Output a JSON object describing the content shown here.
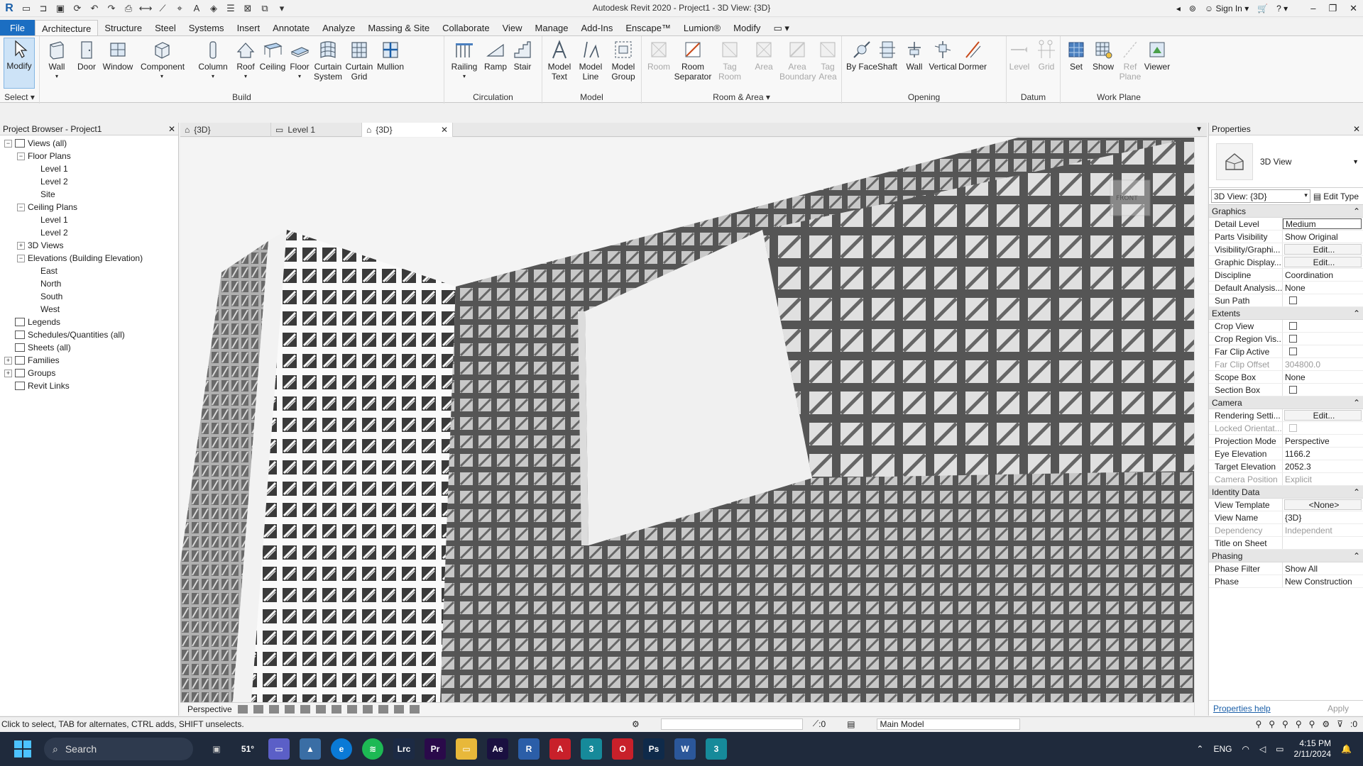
{
  "window": {
    "title": "Autodesk Revit 2020 - Project1 - 3D View: {3D}",
    "sign_in": "Sign In"
  },
  "ribbon_tabs": [
    "File",
    "Architecture",
    "Structure",
    "Steel",
    "Systems",
    "Insert",
    "Annotate",
    "Analyze",
    "Massing & Site",
    "Collaborate",
    "View",
    "Manage",
    "Add-Ins",
    "Enscape™",
    "Lumion®",
    "Modify"
  ],
  "ribbon": {
    "select": {
      "modify": "Modify",
      "title": "Select"
    },
    "build": {
      "title": "Build",
      "wall": "Wall",
      "door": "Door",
      "window": "Window",
      "component": "Component",
      "column": "Column",
      "roof": "Roof",
      "ceiling": "Ceiling",
      "floor": "Floor",
      "curtain_system": "Curtain System",
      "curtain_grid": "Curtain Grid",
      "mullion": "Mullion"
    },
    "circulation": {
      "title": "Circulation",
      "railing": "Railing",
      "ramp": "Ramp",
      "stair": "Stair"
    },
    "model": {
      "title": "Model",
      "model_text": "Model Text",
      "model_line": "Model Line",
      "model_group": "Model Group"
    },
    "room_area": {
      "title": "Room & Area",
      "room": "Room",
      "room_separator": "Room Separator",
      "tag_room": "Tag Room",
      "area": "Area",
      "area_boundary": "Area Boundary",
      "tag_area": "Tag Area"
    },
    "opening": {
      "title": "Opening",
      "by_face": "By Face",
      "shaft": "Shaft",
      "wall": "Wall",
      "vertical": "Vertical",
      "dormer": "Dormer"
    },
    "datum": {
      "title": "Datum",
      "level": "Level",
      "grid": "Grid"
    },
    "work_plane": {
      "title": "Work Plane",
      "set": "Set",
      "show": "Show",
      "ref_plane": "Ref Plane",
      "viewer": "Viewer"
    }
  },
  "project_browser": {
    "title": "Project Browser - Project1",
    "items": [
      {
        "label": "Views (all)",
        "level": 0,
        "exp": "−"
      },
      {
        "label": "Floor Plans",
        "level": 1,
        "exp": "−"
      },
      {
        "label": "Level 1",
        "level": 2,
        "exp": ""
      },
      {
        "label": "Level 2",
        "level": 2,
        "exp": ""
      },
      {
        "label": "Site",
        "level": 2,
        "exp": ""
      },
      {
        "label": "Ceiling Plans",
        "level": 1,
        "exp": "−"
      },
      {
        "label": "Level 1",
        "level": 2,
        "exp": ""
      },
      {
        "label": "Level 2",
        "level": 2,
        "exp": ""
      },
      {
        "label": "3D Views",
        "level": 1,
        "exp": "+"
      },
      {
        "label": "Elevations (Building Elevation)",
        "level": 1,
        "exp": "−"
      },
      {
        "label": "East",
        "level": 2,
        "exp": ""
      },
      {
        "label": "North",
        "level": 2,
        "exp": ""
      },
      {
        "label": "South",
        "level": 2,
        "exp": ""
      },
      {
        "label": "West",
        "level": 2,
        "exp": ""
      },
      {
        "label": "Legends",
        "level": 0,
        "exp": ""
      },
      {
        "label": "Schedules/Quantities (all)",
        "level": 0,
        "exp": ""
      },
      {
        "label": "Sheets (all)",
        "level": 0,
        "exp": ""
      },
      {
        "label": "Families",
        "level": 0,
        "exp": "+"
      },
      {
        "label": "Groups",
        "level": 0,
        "exp": "+"
      },
      {
        "label": "Revit Links",
        "level": 0,
        "exp": ""
      }
    ]
  },
  "view_tabs": [
    {
      "label": "{3D}",
      "active": false
    },
    {
      "label": "Level 1",
      "active": false
    },
    {
      "label": "{3D}",
      "active": true
    }
  ],
  "view_bar": {
    "projection": "Perspective"
  },
  "properties": {
    "title": "Properties",
    "type_name": "3D View",
    "instance": "3D View: {3D}",
    "edit_type": "Edit Type",
    "sections": [
      {
        "name": "Graphics",
        "rows": [
          {
            "name": "Detail Level",
            "value": "Medium",
            "kind": "boxed"
          },
          {
            "name": "Parts Visibility",
            "value": "Show Original",
            "kind": "text"
          },
          {
            "name": "Visibility/Graphi...",
            "value": "Edit...",
            "kind": "button"
          },
          {
            "name": "Graphic Display...",
            "value": "Edit...",
            "kind": "button"
          },
          {
            "name": "Discipline",
            "value": "Coordination",
            "kind": "text"
          },
          {
            "name": "Default Analysis...",
            "value": "None",
            "kind": "text"
          },
          {
            "name": "Sun Path",
            "value": "",
            "kind": "check"
          }
        ]
      },
      {
        "name": "Extents",
        "rows": [
          {
            "name": "Crop View",
            "value": "",
            "kind": "check"
          },
          {
            "name": "Crop Region Vis...",
            "value": "",
            "kind": "check"
          },
          {
            "name": "Far Clip Active",
            "value": "",
            "kind": "check"
          },
          {
            "name": "Far Clip Offset",
            "value": "304800.0",
            "kind": "gray"
          },
          {
            "name": "Scope Box",
            "value": "None",
            "kind": "text"
          },
          {
            "name": "Section Box",
            "value": "",
            "kind": "check"
          }
        ]
      },
      {
        "name": "Camera",
        "rows": [
          {
            "name": "Rendering Setti...",
            "value": "Edit...",
            "kind": "button"
          },
          {
            "name": "Locked Orientat...",
            "value": "",
            "kind": "graycheck"
          },
          {
            "name": "Projection Mode",
            "value": "Perspective",
            "kind": "text"
          },
          {
            "name": "Eye Elevation",
            "value": "1166.2",
            "kind": "text"
          },
          {
            "name": "Target Elevation",
            "value": "2052.3",
            "kind": "text"
          },
          {
            "name": "Camera Position",
            "value": "Explicit",
            "kind": "gray"
          }
        ]
      },
      {
        "name": "Identity Data",
        "rows": [
          {
            "name": "View Template",
            "value": "<None>",
            "kind": "button"
          },
          {
            "name": "View Name",
            "value": "{3D}",
            "kind": "text"
          },
          {
            "name": "Dependency",
            "value": "Independent",
            "kind": "gray"
          },
          {
            "name": "Title on Sheet",
            "value": "",
            "kind": "text"
          }
        ]
      },
      {
        "name": "Phasing",
        "rows": [
          {
            "name": "Phase Filter",
            "value": "Show All",
            "kind": "text"
          },
          {
            "name": "Phase",
            "value": "New Construction",
            "kind": "text"
          }
        ]
      }
    ],
    "help": "Properties help",
    "apply": "Apply"
  },
  "status": {
    "hint": "Click to select, TAB for alternates, CTRL adds, SHIFT unselects.",
    "design_option_count": ":0",
    "model": "Main Model",
    "filter_count": ":0"
  },
  "taskbar": {
    "search": "Search",
    "language": "ENG",
    "time": "4:15 PM",
    "date": "2/11/2024",
    "temp": "51°",
    "apps": [
      {
        "label": "Lrc",
        "color": "#1c2a44"
      },
      {
        "label": "Pr",
        "color": "#2a0a4a"
      },
      {
        "label": "Ae",
        "color": "#1a1040"
      },
      {
        "label": "R",
        "color": "#2b5ea8"
      },
      {
        "label": "A",
        "color": "#c8202a"
      },
      {
        "label": "3",
        "color": "#168a9a"
      },
      {
        "label": "O",
        "color": "#c8202a"
      },
      {
        "label": "Ps",
        "color": "#0f2a4a"
      },
      {
        "label": "W",
        "color": "#2b579a"
      },
      {
        "label": "3",
        "color": "#168a9a"
      }
    ]
  }
}
